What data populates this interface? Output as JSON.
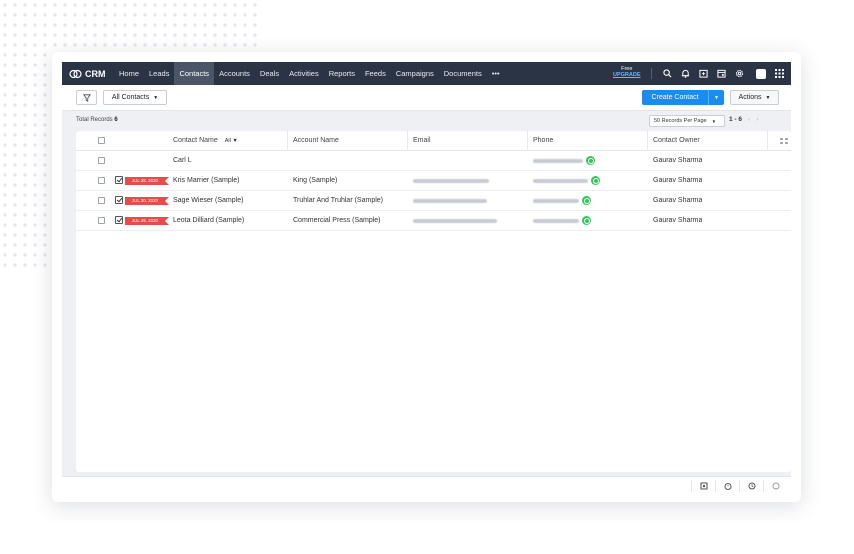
{
  "app": {
    "logo_text": "CRM"
  },
  "nav": {
    "items": [
      {
        "label": "Home",
        "active": false
      },
      {
        "label": "Leads",
        "active": false
      },
      {
        "label": "Contacts",
        "active": true
      },
      {
        "label": "Accounts",
        "active": false
      },
      {
        "label": "Deals",
        "active": false
      },
      {
        "label": "Activities",
        "active": false
      },
      {
        "label": "Reports",
        "active": false
      },
      {
        "label": "Feeds",
        "active": false
      },
      {
        "label": "Campaigns",
        "active": false
      },
      {
        "label": "Documents",
        "active": false
      },
      {
        "label": "•••",
        "active": false
      }
    ],
    "plan_label": "Free",
    "upgrade_label": "UPGRADE",
    "icons": [
      "search-icon",
      "bell-icon",
      "calendar-add-icon",
      "calendar-icon",
      "gear-icon",
      "avatar",
      "apps-grid-icon"
    ]
  },
  "toolbar": {
    "filter_icon": "filter-icon",
    "view_label": "All Contacts",
    "create_label": "Create Contact",
    "actions_label": "Actions"
  },
  "records": {
    "total_label": "Total Records",
    "total_count": "6",
    "per_page": "50 Records Per Page",
    "range": "1 - 6"
  },
  "table": {
    "columns": {
      "contact_name": "Contact Name",
      "filter": "All",
      "account_name": "Account Name",
      "email": "Email",
      "phone": "Phone",
      "owner": "Contact Owner"
    },
    "rows": [
      {
        "name": "Carl L",
        "tag": "",
        "account": "",
        "owner": "Gaurav Sharma"
      },
      {
        "name": "Kris Marrier (Sample)",
        "tag": "JUL 28, 2020",
        "account": "King (Sample)",
        "owner": "Gaurav Sharma"
      },
      {
        "name": "Sage Wieser (Sample)",
        "tag": "JUL 30, 2020",
        "account": "Truhlar And Truhlar (Sample)",
        "owner": "Gaurav Sharma"
      },
      {
        "name": "Leota Dilliard (Sample)",
        "tag": "JUL 29, 2020",
        "account": "Commercial Press (Sample)",
        "owner": "Gaurav Sharma"
      }
    ]
  },
  "colors": {
    "topbar": "#2b3445",
    "primary": "#1a8cf0",
    "tag": "#e74c4c",
    "whatsapp": "#33c45a"
  }
}
